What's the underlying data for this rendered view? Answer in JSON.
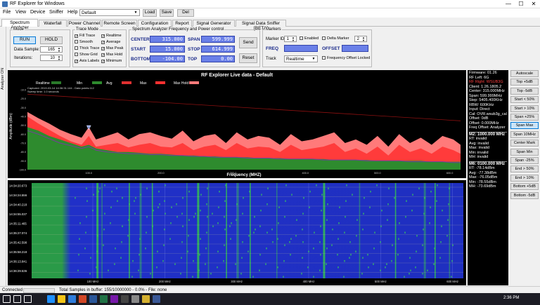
{
  "window": {
    "title": "RF Explorer for Windows",
    "controls": [
      "—",
      "☐",
      "✕"
    ]
  },
  "menu": {
    "items": [
      "File",
      "View",
      "Device",
      "Sniffer",
      "Help"
    ],
    "profile_combo": "Default",
    "load_label": "Load",
    "save_label": "Save",
    "del_label": "Del"
  },
  "tabs": [
    "Spectrum Analyzer",
    "Waterfall",
    "Power Channel",
    "Remote Screen",
    "Configuration",
    "Report",
    "Signal Generator",
    "Signal Data Sniffer [BETA]"
  ],
  "sidebar": {
    "vertical_label": "Analyzer ON"
  },
  "mode": {
    "group_title": "Mode",
    "run_label": "RUN",
    "hold_label": "HOLD",
    "data_sample_label": "Data Sample:",
    "data_sample_value": "165",
    "iterations_label": "Iterations:",
    "iterations_value": "10"
  },
  "trace_mode": {
    "group_title": "Trace Mode",
    "options": [
      {
        "label": "Fill Trace",
        "checked": true
      },
      {
        "label": "Smooth",
        "checked": false
      },
      {
        "label": "Thick Trace",
        "checked": false
      },
      {
        "label": "Show Grid",
        "checked": false
      },
      {
        "label": "Axis Labels",
        "checked": true
      },
      {
        "label": "Realtime",
        "checked": true
      },
      {
        "label": "Average",
        "checked": true
      },
      {
        "label": "Max Peak",
        "checked": true
      },
      {
        "label": "Max Hold",
        "checked": true
      },
      {
        "label": "Minimum",
        "checked": true
      }
    ]
  },
  "freq_control": {
    "group_title": "Spectrum Analyzer Frequency and Power control",
    "center_label": "CENTER",
    "center_value": "315.000",
    "start_label": "START",
    "start_value": "15.000",
    "bottom_label": "BOTTOM",
    "bottom_value": "-104.00",
    "span_label": "SPAN",
    "span_value": "599.999",
    "stop_label": "STOP",
    "stop_value": "614.999",
    "top_label": "TOP",
    "top_value": "0.00",
    "send_label": "Send",
    "reset_label": "Reset"
  },
  "markers": {
    "group_title": "Markers",
    "marker_id_label": "Marker ID",
    "marker_id_value": "1",
    "enabled_label": "Enabled",
    "delta_label": "Delta Marker",
    "delta_value": "2",
    "freq_label": "FREQ",
    "offset_label": "OFFSET",
    "track_label": "Track",
    "track_value": "Realtime",
    "offset_locked_label": "Frequency Offset Locked"
  },
  "chart_data": {
    "type": "area",
    "title": "RF Explorer Live data - Default",
    "xlabel": "Frequency (MHZ)",
    "ylabel": "Amplitude (dBm)",
    "xlim": [
      15,
      615
    ],
    "ylim": [
      -100,
      -10
    ],
    "x_ticks": [
      "100.0",
      "200.0",
      "300.0",
      "400.0",
      "500.0",
      "600.0"
    ],
    "y_ticks": [
      "-10.0",
      "-20.0",
      "-30.0",
      "-40.0",
      "-50.0",
      "-60.0",
      "-70.0",
      "-80.0",
      "-90.0",
      "-100.0"
    ],
    "legend": [
      "Realtime",
      "Min",
      "Avg",
      "Max",
      "Max Hold"
    ],
    "legend_colors": [
      "#2a7a2a",
      "#2e8b2e",
      "#e03030",
      "#ff3030",
      "#ff7a7a"
    ],
    "annotation_lines": [
      "Captured: 2019-03-14  14:36:31.144 - Data points:112",
      "Sweep time: 1.0 seconds"
    ],
    "marker_label": "1",
    "x": [
      15,
      30,
      45,
      60,
      75,
      90,
      100,
      110,
      125,
      140,
      155,
      170,
      185,
      200,
      215,
      230,
      245,
      260,
      275,
      290,
      305,
      320,
      335,
      350,
      365,
      380,
      395,
      410,
      425,
      440,
      455,
      470,
      485,
      500,
      515,
      530,
      545,
      560,
      575,
      590,
      605,
      615
    ],
    "series": [
      {
        "name": "Max Hold",
        "values": [
          -35,
          -42,
          -48,
          -55,
          -60,
          -64,
          -52,
          -66,
          -62,
          -58,
          -66,
          -60,
          -58,
          -62,
          -65,
          -56,
          -68,
          -62,
          -60,
          -70,
          -58,
          -66,
          -62,
          -64,
          -72,
          -60,
          -68,
          -66,
          -62,
          -58,
          -70,
          -66,
          -72,
          -62,
          -74,
          -60,
          -70,
          -64,
          -72,
          -62,
          -66,
          -72
        ]
      },
      {
        "name": "Max",
        "values": [
          -40,
          -48,
          -55,
          -62,
          -68,
          -72,
          -62,
          -74,
          -72,
          -70,
          -75,
          -72,
          -70,
          -74,
          -75,
          -70,
          -78,
          -74,
          -72,
          -78,
          -70,
          -76,
          -74,
          -75,
          -80,
          -72,
          -78,
          -76,
          -74,
          -70,
          -80,
          -76,
          -82,
          -74,
          -84,
          -72,
          -80,
          -76,
          -82,
          -74,
          -78,
          -82
        ]
      },
      {
        "name": "Min",
        "values": [
          -52,
          -56,
          -62,
          -66,
          -70,
          -74,
          -72,
          -76,
          -78,
          -80,
          -80,
          -81,
          -82,
          -82,
          -83,
          -84,
          -84,
          -85,
          -85,
          -86,
          -86,
          -86,
          -87,
          -87,
          -87,
          -88,
          -88,
          -88,
          -88,
          -89,
          -89,
          -89,
          -89,
          -90,
          -90,
          -90,
          -90,
          -90,
          -91,
          -91,
          -91,
          -91
        ]
      },
      {
        "name": "Avg",
        "values": [
          -56,
          -60,
          -65,
          -70,
          -73,
          -76,
          -74,
          -78,
          -80,
          -81,
          -82,
          -82,
          -83,
          -83,
          -84,
          -84,
          -85,
          -85,
          -86,
          -86,
          -86,
          -87,
          -87,
          -87,
          -88,
          -88,
          -88,
          -88,
          -89,
          -89,
          -89,
          -89,
          -90,
          -90,
          -90,
          -90,
          -91,
          -91,
          -91,
          -91,
          -92,
          -92
        ]
      }
    ],
    "threshold_line": {
      "values_at_x": [
        -15,
        -45
      ]
    }
  },
  "waterfall": {
    "timestamps": [
      "14:34:20.673",
      "14:34:24.556",
      "14:34:40.218",
      "14:34:55.037",
      "14:35:11.465",
      "14:35:27.074",
      "14:35:42.598",
      "14:35:58.218",
      "14:36:13.841",
      "14:36:29.536"
    ],
    "x_ticks": [
      "100 MHz",
      "200 MHz",
      "300 MHz",
      "400 MHz",
      "500 MHz",
      "600 MHz"
    ]
  },
  "info_panel": {
    "lines_top": [
      "Firmware: 01.26",
      "RF Left: 6G",
      "RF Right: WSUB3G",
      "Client: 1.26.1805.2",
      "Center: 315.000MHz",
      "Span: 599.999MHz",
      "Step: 5405.400KHz",
      "RBW: 600KHz",
      "Input: Direct",
      "Cal: OVR.wsub3g_cal",
      "Offset: 0dB",
      "Offset: 0.000MHz",
      "Freq Offset: Analyzer"
    ],
    "m2_header": "M2: 1000.000 MHz",
    "m2_lines": [
      "RT: invalid",
      "Avg: invalid",
      "Max: invalid",
      "Min: invalid",
      "MH: invalid"
    ],
    "m6_header": "M6: 0100.000 MHz",
    "m6_lines": [
      "RT: -78.14dBm",
      "Avg: -77.38dBm",
      "Max: -76.05dBm",
      "Min: -78.55dBm",
      "MH: -73.69dBm"
    ]
  },
  "right_buttons": [
    "Autoscale",
    "Top +5dB",
    "Top -5dB",
    "Start < 50%",
    "Start > 10%",
    "Span +25%",
    "Span Max",
    "Span 10MHz",
    "Center Mark",
    "Span Min",
    "Span -25%",
    "End > 50%",
    "End > 10%",
    "Bottom +5dB",
    "Bottom -5dB"
  ],
  "status": {
    "connection": "Connected",
    "text": "Total Samples in buffer: 155/10000000 - 0.0%  - File: none"
  },
  "taskbar": {
    "time": "2:36 PM",
    "icons": [
      "windows-icon",
      "search-icon",
      "task-view-icon",
      "edge-icon",
      "explorer-icon",
      "store-icon",
      "powerpoint-icon",
      "word-icon",
      "excel-icon",
      "onenote-icon",
      "app1-icon",
      "app2-icon",
      "rfexplorer-icon",
      "app3-icon"
    ],
    "icon_colors": [
      "#ffffff",
      "#ffffff",
      "#ffffff",
      "#1e90ff",
      "#f5c518",
      "#2f7ddc",
      "#d24726",
      "#2b579a",
      "#217346",
      "#7719aa",
      "#444444",
      "#888888",
      "#d4b030",
      "#3b5998"
    ]
  }
}
